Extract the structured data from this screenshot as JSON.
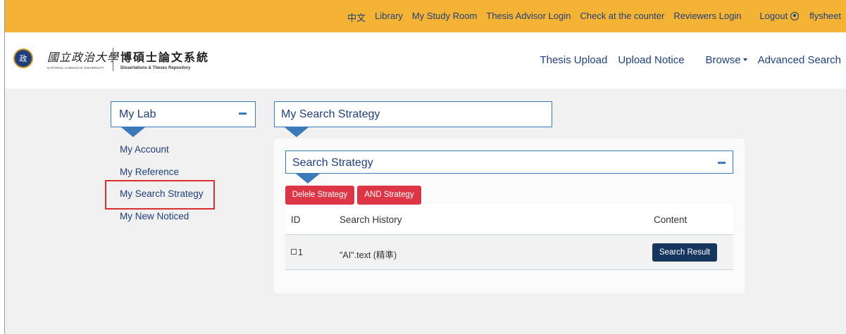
{
  "topbar": {
    "links": [
      "中文",
      "Library",
      "My Study Room",
      "Thesis Advisor Login",
      "Check at the counter",
      "Reviewers Login"
    ],
    "logout_label": "Logout",
    "username": "flysheet"
  },
  "header": {
    "school_logo_text": "國立政治大學",
    "school_logo_en": "NATIONAL CHENGCHI UNIVERSITY",
    "repo_name_cn": "博碩士論文系統",
    "repo_name_en": "Dissertations & Theses Repository",
    "nav": [
      "Thesis Upload",
      "Upload Notice",
      "Browse",
      "Advanced Search"
    ]
  },
  "sidebar": {
    "title": "My Lab",
    "items": [
      "My Account",
      "My Reference",
      "My Search Strategy",
      "My New Noticed"
    ]
  },
  "main": {
    "title": "My Search Strategy",
    "section_title": "Search Strategy",
    "buttons": {
      "delete": "Delele Strategy",
      "and": "AND Strategy"
    },
    "table": {
      "headers": [
        "ID",
        "Search History",
        "Content"
      ],
      "rows": [
        {
          "id": "1",
          "history": "\"AI\".text (精準)",
          "action": "Search Result"
        }
      ]
    }
  },
  "colors": {
    "topbar": "#f5b335",
    "primary_text": "#1f3f7a",
    "panel_border": "#3b7ab8",
    "danger": "#dc3545",
    "dark_button": "#17365f",
    "highlight": "#d93030"
  }
}
